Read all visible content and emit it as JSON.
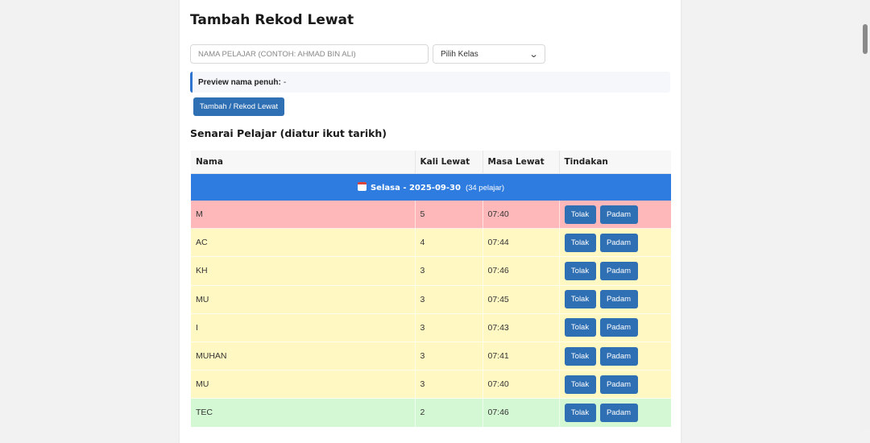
{
  "form": {
    "title": "Tambah Rekod Lewat",
    "name_placeholder": "NAMA PELAJAR (CONTOH: AHMAD BIN ALI)",
    "class_select": "Pilih Kelas",
    "preview_label": "Preview nama penuh:",
    "preview_value": "-",
    "add_button": "Tambah / Rekod Lewat"
  },
  "list": {
    "title": "Senarai Pelajar (diatur ikut tarikh)",
    "columns": [
      "Nama",
      "Kali Lewat",
      "Masa Lewat",
      "Tindakan"
    ],
    "group": {
      "label": "Selasa - 2025-09-30",
      "count": "(34 pelajar)"
    },
    "action_labels": {
      "reject": "Tolak",
      "delete": "Padam"
    },
    "rows": [
      {
        "name": "M",
        "times": "5",
        "time": "07:40",
        "status_color": "#ffb8ba"
      },
      {
        "name": "AC",
        "times": "4",
        "time": "07:44",
        "status_color": "#fff8c2"
      },
      {
        "name": "KH",
        "times": "3",
        "time": "07:46",
        "status_color": "#fff8c2"
      },
      {
        "name": "MU",
        "times": "3",
        "time": "07:45",
        "status_color": "#fff8c2"
      },
      {
        "name": "I",
        "times": "3",
        "time": "07:43",
        "status_color": "#fff8c2"
      },
      {
        "name": "MUHAN",
        "times": "3",
        "time": "07:41",
        "status_color": "#fff8c2"
      },
      {
        "name": "MU",
        "times": "3",
        "time": "07:40",
        "status_color": "#fff8c2"
      },
      {
        "name": "TEC",
        "times": "2",
        "time": "07:46",
        "status_color": "#d4f7d4"
      }
    ]
  },
  "colors": {
    "accent": "#2f6fb3",
    "group_header": "#2f7ce0"
  }
}
